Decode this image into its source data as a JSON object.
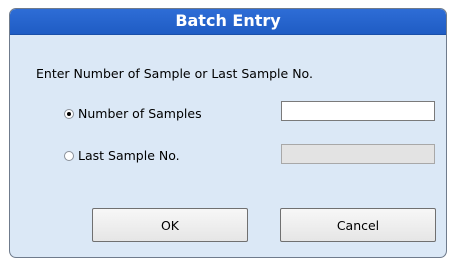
{
  "dialog": {
    "title": "Batch Entry",
    "prompt": "Enter Number of Sample or Last Sample No.",
    "options": [
      {
        "label": "Number of Samples",
        "selected": true,
        "field_value": "",
        "field_enabled": true
      },
      {
        "label": "Last Sample No.",
        "selected": false,
        "field_value": "",
        "field_enabled": false
      }
    ],
    "buttons": {
      "ok": "OK",
      "cancel": "Cancel"
    }
  },
  "colors": {
    "titlebar": "#2e6dd6",
    "dialog_background": "#dbe8f6",
    "disabled_field": "#e3e3e3"
  }
}
